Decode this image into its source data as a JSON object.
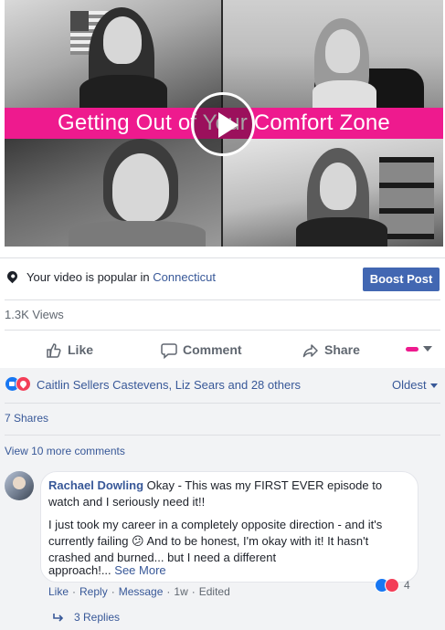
{
  "video": {
    "banner_title": "Getting Out of Your Comfort Zone",
    "play_icon": "play-icon",
    "banner_color": "#ee1a8e"
  },
  "popular": {
    "prefix": "Your video is popular in ",
    "location": "Connecticut",
    "boost_label": "Boost Post",
    "icon": "location-pin-icon"
  },
  "stats": {
    "views": "1.3K Views"
  },
  "actions": {
    "like": "Like",
    "comment": "Comment",
    "share": "Share"
  },
  "reactions": {
    "names": "Caitlin Sellers Castevens, Liz Sears and 28 others",
    "sort_label": "Oldest"
  },
  "shares": "7 Shares",
  "more_comments": "View 10 more comments",
  "comment": {
    "author": "Rachael Dowling",
    "text_line1": " Okay - This was my FIRST EVER episode to",
    "text_line2": "watch and I seriously need it!!",
    "text_line3": "I just took my career in a completely opposite direction - and it's",
    "text_line4a": "currently failing ",
    "emoji": "😕",
    "text_line4b": " And to be honest, I'm okay with it! It hasn't",
    "text_line5": "crashed and burned... but I need a different",
    "text_line6": "approach!...",
    "see_more": " See More",
    "reaction_count": "4",
    "like": "Like",
    "reply": "Reply",
    "message": "Message",
    "time": "1w",
    "edited": "Edited",
    "replies": "3 Replies"
  },
  "colors": {
    "link": "#385898",
    "boost": "#4267b2",
    "like_blue": "#1877f2",
    "love_red": "#f33e58"
  }
}
